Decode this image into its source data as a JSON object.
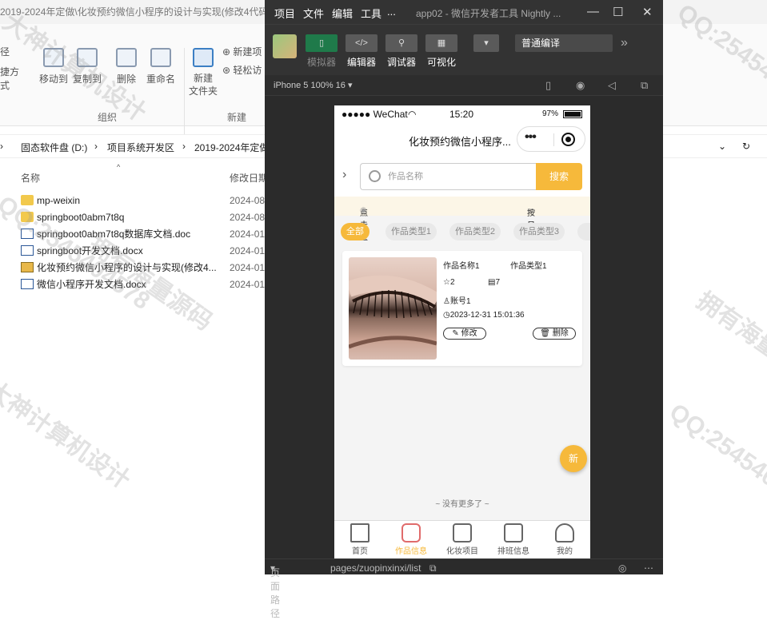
{
  "explorer": {
    "title": "2019-2024年定做\\化妆预约微信小程序的设计与实现(修改4代码",
    "ribbon": {
      "left_labels": [
        "径",
        "捷方式"
      ],
      "move_to": "移动到",
      "copy_to": "复制到",
      "delete": "删除",
      "rename": "重命名",
      "new_folder": "新建\n文件夹",
      "new_item": "新建项",
      "easy_access": "轻松访",
      "group_organize": "组织",
      "group_new": "新建"
    },
    "breadcrumb": [
      "固态软件盘 (D:)",
      "项目系统开发区",
      "2019-2024年定做"
    ],
    "columns": {
      "name": "名称",
      "date": "修改日期"
    },
    "files": [
      {
        "name": "mp-weixin",
        "type": "folder",
        "date": "2024-08"
      },
      {
        "name": "springboot0abm7t8q",
        "type": "folder",
        "date": "2024-08"
      },
      {
        "name": "springboot0abm7t8q数据库文档.doc",
        "type": "doc",
        "date": "2024-01"
      },
      {
        "name": "springboot开发文档.docx",
        "type": "doc",
        "date": "2024-01"
      },
      {
        "name": "化妆预约微信小程序的设计与实现(修改4...",
        "type": "zip",
        "date": "2024-01"
      },
      {
        "name": "微信小程序开发文档.docx",
        "type": "doc",
        "date": "2024-01"
      }
    ]
  },
  "devtools": {
    "menus": [
      "项目",
      "文件",
      "编辑",
      "工具",
      "..."
    ],
    "app_title": "app02 - 微信开发者工具 Nightly ...",
    "toolbar": [
      {
        "label": "模拟器",
        "dim": true
      },
      {
        "label": "编辑器",
        "dim": false
      },
      {
        "label": "调试器",
        "dim": false
      },
      {
        "label": "可视化",
        "dim": false
      }
    ],
    "compile_mode": "普通编译",
    "device": "iPhone 5 100% 16 ▾",
    "status_path_label": "页面路径",
    "status_path": "pages/zuopinxinxi/list"
  },
  "phone": {
    "status": {
      "carrier": "●●●●● WeChat",
      "time": "15:20",
      "battery": "97%"
    },
    "nav_title": "化妆预约微信小程序...",
    "search": {
      "placeholder": "作品名称",
      "button": "搜索"
    },
    "sort": {
      "clicks": "点击量",
      "by_date": "按日期"
    },
    "categories": [
      "全部",
      "作品类型1",
      "作品类型2",
      "作品类型3"
    ],
    "card": {
      "name": "作品名称1",
      "type": "作品类型1",
      "likes": "2",
      "views": "7",
      "account": "账号1",
      "time": "2023-12-31 15:01:36",
      "edit": "修改",
      "delete": "删除"
    },
    "no_more": "~ 没有更多了 ~",
    "fab": "新",
    "tabs": [
      "首页",
      "作品信息",
      "化妆项目",
      "排班信息",
      "我的"
    ],
    "active_tab": 1
  },
  "watermarks": [
    "大神计算机设计",
    "QQ:2545404578",
    "拥有海量源码",
    "大神计算机设计",
    "QQ:2545404578"
  ],
  "colors": {
    "accent": "#f6b93b",
    "tab_active_icon": "#e06b6b",
    "dev_bg": "#2b2b2b"
  }
}
